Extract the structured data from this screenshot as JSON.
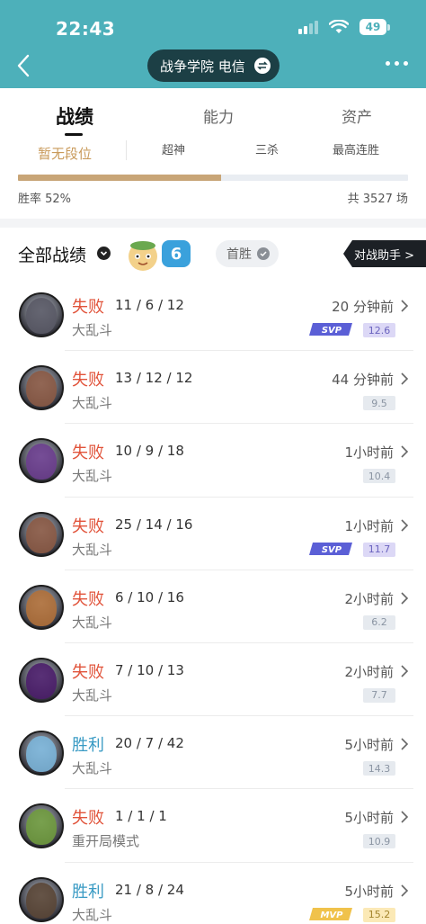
{
  "status_bar": {
    "time": "22:43",
    "battery": "49"
  },
  "header": {
    "server": "战争学院 电信"
  },
  "tabs": [
    {
      "label": "战绩",
      "active": true
    },
    {
      "label": "能力",
      "active": false
    },
    {
      "label": "资产",
      "active": false
    }
  ],
  "rank": {
    "tier": "暂无段位",
    "stats": [
      "超神",
      "三杀",
      "最高连胜"
    ],
    "win_rate_label": "胜率 52%",
    "win_rate": 0.52,
    "total_label": "共 3527 场"
  },
  "section": {
    "title": "全部战绩",
    "streak": "6",
    "first_win": "首胜",
    "assistant": "对战助手 >"
  },
  "matches": [
    {
      "result": "失败",
      "outcome": "lose",
      "kda": "11 / 6 / 12",
      "mode": "大乱斗",
      "time": "20 分钟前",
      "score": "12.6",
      "tag": "SVP",
      "face": "#5a5a66"
    },
    {
      "result": "失败",
      "outcome": "lose",
      "kda": "13 / 12 / 12",
      "mode": "大乱斗",
      "time": "44 分钟前",
      "score": "9.5",
      "tag": "",
      "face": "#8b5a45"
    },
    {
      "result": "失败",
      "outcome": "lose",
      "kda": "10 / 9 / 18",
      "mode": "大乱斗",
      "time": "1小时前",
      "score": "10.4",
      "tag": "",
      "face": "#6b3e8e"
    },
    {
      "result": "失败",
      "outcome": "lose",
      "kda": "25 / 14 / 16",
      "mode": "大乱斗",
      "time": "1小时前",
      "score": "11.7",
      "tag": "SVP",
      "face": "#8b5a45"
    },
    {
      "result": "失败",
      "outcome": "lose",
      "kda": "6 / 10 / 16",
      "mode": "大乱斗",
      "time": "2小时前",
      "score": "6.2",
      "tag": "",
      "face": "#b0703a"
    },
    {
      "result": "失败",
      "outcome": "lose",
      "kda": "7 / 10 / 13",
      "mode": "大乱斗",
      "time": "2小时前",
      "score": "7.7",
      "tag": "",
      "face": "#4b1e6a"
    },
    {
      "result": "胜利",
      "outcome": "win",
      "kda": "20 / 7 / 42",
      "mode": "大乱斗",
      "time": "5小时前",
      "score": "14.3",
      "tag": "",
      "face": "#7bb4d8"
    },
    {
      "result": "失败",
      "outcome": "lose",
      "kda": "1 / 1 / 1",
      "mode": "重开局模式",
      "time": "5小时前",
      "score": "10.9",
      "tag": "",
      "face": "#6f9a3e"
    },
    {
      "result": "胜利",
      "outcome": "win",
      "kda": "21 / 8 / 24",
      "mode": "大乱斗",
      "time": "5小时前",
      "score": "15.2",
      "tag": "MVP",
      "face": "#5a4636"
    }
  ]
}
